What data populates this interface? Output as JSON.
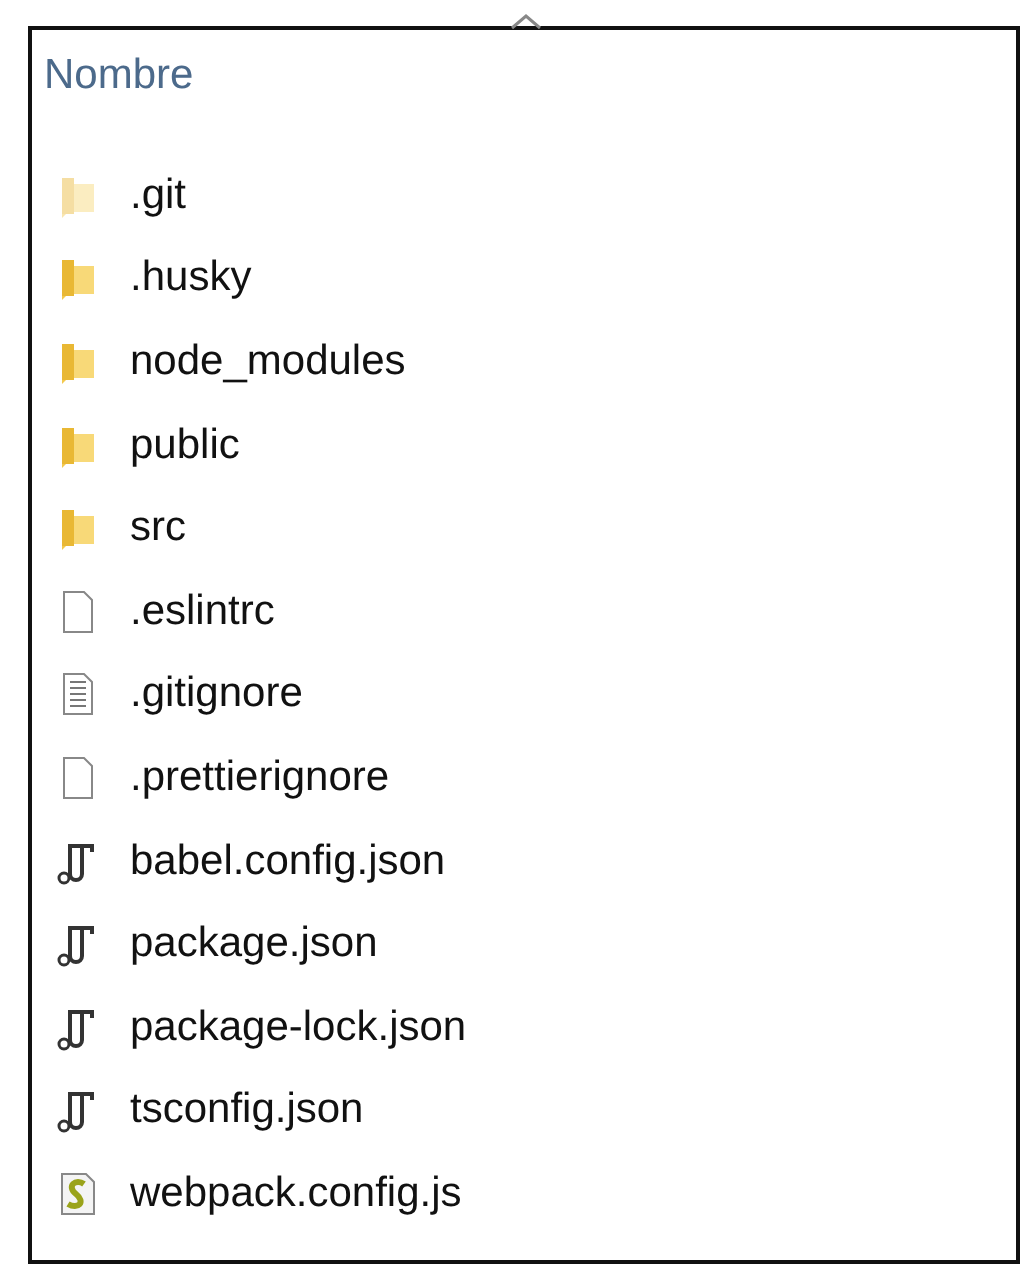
{
  "column_header": {
    "label": "Nombre",
    "sort_ascending": true
  },
  "files": [
    {
      "name": ".git",
      "kind": "folder",
      "hidden": true
    },
    {
      "name": ".husky",
      "kind": "folder",
      "hidden": false
    },
    {
      "name": "node_modules",
      "kind": "folder",
      "hidden": false
    },
    {
      "name": "public",
      "kind": "folder",
      "hidden": false
    },
    {
      "name": "src",
      "kind": "folder",
      "hidden": false
    },
    {
      "name": ".eslintrc",
      "kind": "file",
      "hidden": false
    },
    {
      "name": ".gitignore",
      "kind": "text",
      "hidden": false
    },
    {
      "name": ".prettierignore",
      "kind": "file",
      "hidden": false
    },
    {
      "name": "babel.config.json",
      "kind": "json",
      "hidden": false
    },
    {
      "name": "package.json",
      "kind": "json",
      "hidden": false
    },
    {
      "name": "package-lock.json",
      "kind": "json",
      "hidden": false
    },
    {
      "name": "tsconfig.json",
      "kind": "json",
      "hidden": false
    },
    {
      "name": "webpack.config.js",
      "kind": "script",
      "hidden": false
    }
  ]
}
